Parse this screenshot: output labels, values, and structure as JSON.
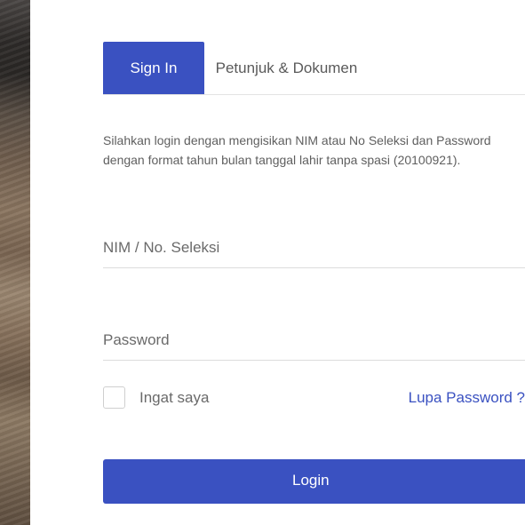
{
  "tabs": [
    {
      "label": "Sign In",
      "active": true
    },
    {
      "label": "Petunjuk & Dokumen",
      "active": false
    }
  ],
  "description": "Silahkan login dengan mengisikan NIM atau No Seleksi dan Password dengan format tahun bulan tanggal lahir tanpa spasi (20100921).",
  "form": {
    "nim_placeholder": "NIM / No. Seleksi",
    "nim_value": "",
    "password_placeholder": "Password",
    "password_value": "",
    "remember_label": "Ingat saya",
    "remember_checked": false,
    "forgot_label": "Lupa Password ?",
    "login_label": "Login"
  },
  "colors": {
    "accent": "#3a51c1",
    "text_muted": "#5f5f5f",
    "border": "#dcdcdc"
  }
}
